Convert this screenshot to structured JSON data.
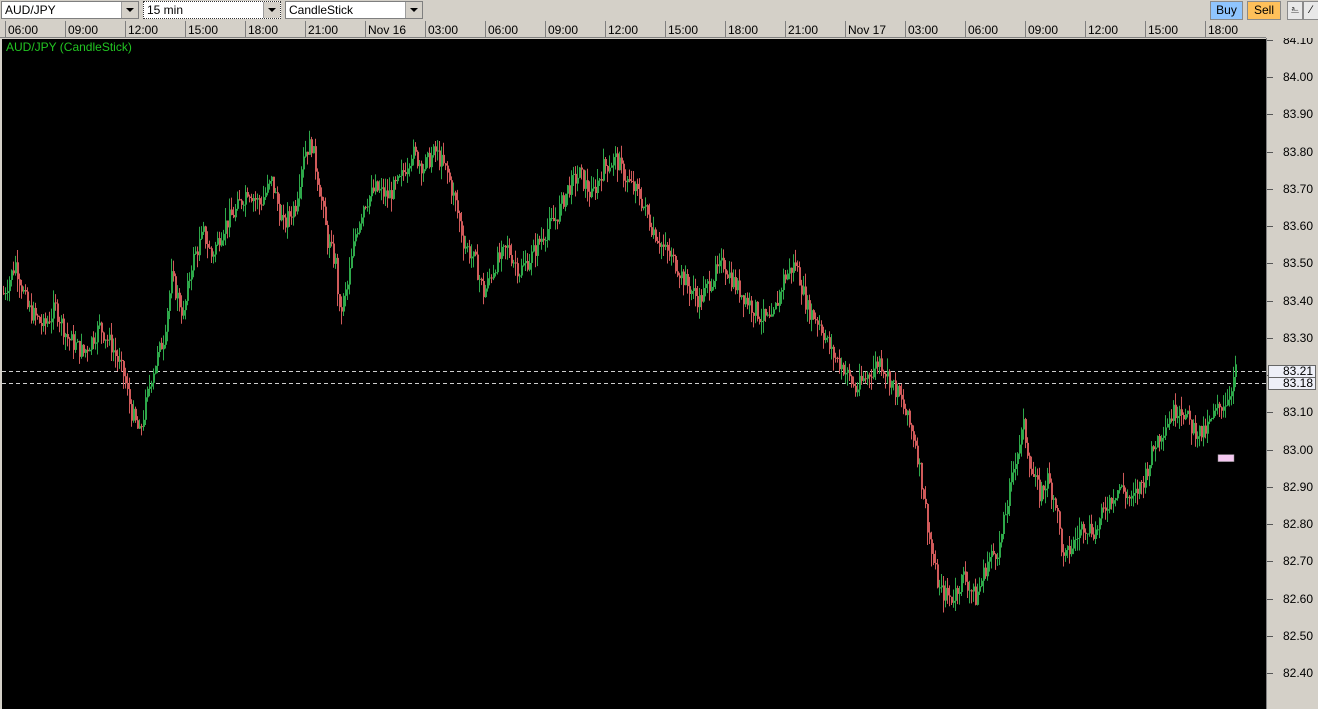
{
  "toolbar": {
    "symbol": "AUD/JPY",
    "interval": "15 min",
    "chart_type": "CandleStick",
    "buy_label": "Buy",
    "sell_label": "Sell",
    "buy_color": "#8fc5ff",
    "sell_color": "#ffc05a"
  },
  "chart_data": {
    "type": "candlestick",
    "title": "AUD/JPY (CandleStick)",
    "ylim": [
      82.36,
      84.1
    ],
    "y_ticks": [
      "84.10",
      "84.00",
      "83.90",
      "83.80",
      "83.70",
      "83.60",
      "83.50",
      "83.40",
      "83.30",
      "83.20",
      "83.10",
      "83.00",
      "82.90",
      "82.80",
      "82.70",
      "82.60",
      "82.50",
      "82.40"
    ],
    "x_ticks": [
      "06:00",
      "09:00",
      "12:00",
      "15:00",
      "18:00",
      "21:00",
      "Nov 16",
      "03:00",
      "06:00",
      "09:00",
      "12:00",
      "15:00",
      "18:00",
      "21:00",
      "Nov 17",
      "03:00",
      "06:00",
      "09:00",
      "12:00",
      "15:00",
      "18:00"
    ],
    "price_lines": [
      {
        "label": "83.21",
        "value": 83.21
      },
      {
        "label": "83.18",
        "value": 83.18
      }
    ],
    "up_color": "#2ea84a",
    "down_color": "#d05a5a",
    "price_path": [
      [
        0,
        83.42
      ],
      [
        6,
        83.5
      ],
      [
        12,
        83.38
      ],
      [
        20,
        83.33
      ],
      [
        26,
        83.38
      ],
      [
        32,
        83.3
      ],
      [
        40,
        83.26
      ],
      [
        48,
        83.33
      ],
      [
        54,
        83.28
      ],
      [
        60,
        83.2
      ],
      [
        64,
        83.1
      ],
      [
        68,
        83.04
      ],
      [
        74,
        83.2
      ],
      [
        80,
        83.3
      ],
      [
        84,
        83.46
      ],
      [
        90,
        83.36
      ],
      [
        94,
        83.5
      ],
      [
        100,
        83.58
      ],
      [
        104,
        83.52
      ],
      [
        110,
        83.6
      ],
      [
        116,
        83.64
      ],
      [
        122,
        83.7
      ],
      [
        128,
        83.66
      ],
      [
        134,
        83.72
      ],
      [
        140,
        83.6
      ],
      [
        146,
        83.66
      ],
      [
        150,
        83.8
      ],
      [
        154,
        83.82
      ],
      [
        158,
        83.7
      ],
      [
        162,
        83.56
      ],
      [
        166,
        83.5
      ],
      [
        168,
        83.36
      ],
      [
        172,
        83.44
      ],
      [
        176,
        83.58
      ],
      [
        180,
        83.66
      ],
      [
        186,
        83.7
      ],
      [
        192,
        83.68
      ],
      [
        198,
        83.72
      ],
      [
        204,
        83.8
      ],
      [
        210,
        83.76
      ],
      [
        216,
        83.8
      ],
      [
        222,
        83.74
      ],
      [
        226,
        83.66
      ],
      [
        230,
        83.56
      ],
      [
        236,
        83.5
      ],
      [
        240,
        83.42
      ],
      [
        246,
        83.5
      ],
      [
        252,
        83.54
      ],
      [
        258,
        83.48
      ],
      [
        264,
        83.52
      ],
      [
        270,
        83.58
      ],
      [
        276,
        83.62
      ],
      [
        282,
        83.7
      ],
      [
        288,
        83.74
      ],
      [
        294,
        83.68
      ],
      [
        300,
        83.76
      ],
      [
        306,
        83.78
      ],
      [
        312,
        83.72
      ],
      [
        318,
        83.68
      ],
      [
        324,
        83.6
      ],
      [
        330,
        83.54
      ],
      [
        336,
        83.5
      ],
      [
        342,
        83.44
      ],
      [
        348,
        83.4
      ],
      [
        354,
        83.46
      ],
      [
        360,
        83.5
      ],
      [
        366,
        83.44
      ],
      [
        372,
        83.4
      ],
      [
        378,
        83.36
      ],
      [
        384,
        83.34
      ],
      [
        390,
        83.46
      ],
      [
        396,
        83.5
      ],
      [
        402,
        83.38
      ],
      [
        408,
        83.34
      ],
      [
        414,
        83.26
      ],
      [
        420,
        83.22
      ],
      [
        426,
        83.16
      ],
      [
        432,
        83.2
      ],
      [
        438,
        83.24
      ],
      [
        444,
        83.18
      ],
      [
        448,
        83.14
      ],
      [
        452,
        83.08
      ],
      [
        456,
        83.02
      ],
      [
        460,
        82.88
      ],
      [
        464,
        82.72
      ],
      [
        468,
        82.62
      ],
      [
        474,
        82.6
      ],
      [
        480,
        82.66
      ],
      [
        486,
        82.6
      ],
      [
        492,
        82.7
      ],
      [
        498,
        82.74
      ],
      [
        502,
        82.86
      ],
      [
        506,
        82.98
      ],
      [
        510,
        83.06
      ],
      [
        514,
        82.94
      ],
      [
        518,
        82.88
      ],
      [
        522,
        82.92
      ],
      [
        526,
        82.86
      ],
      [
        530,
        82.7
      ],
      [
        534,
        82.74
      ],
      [
        540,
        82.8
      ],
      [
        546,
        82.78
      ],
      [
        552,
        82.86
      ],
      [
        558,
        82.9
      ],
      [
        564,
        82.86
      ],
      [
        570,
        82.92
      ],
      [
        576,
        83.02
      ],
      [
        582,
        83.08
      ],
      [
        588,
        83.12
      ],
      [
        594,
        83.06
      ],
      [
        600,
        83.04
      ],
      [
        606,
        83.1
      ],
      [
        612,
        83.14
      ],
      [
        616,
        83.21
      ]
    ]
  }
}
